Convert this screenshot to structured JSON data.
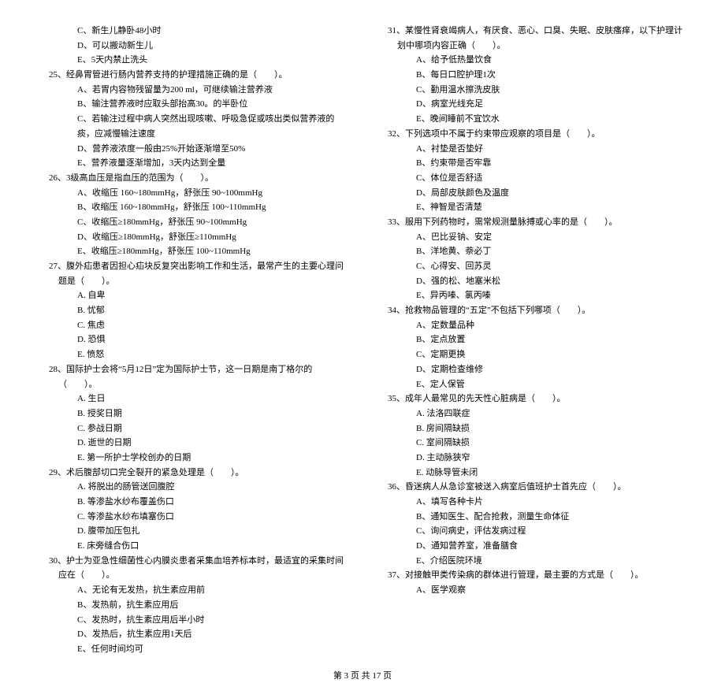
{
  "left": {
    "preC": "C、新生儿静卧48小时",
    "preD": "D、可以搬动新生儿",
    "preE": "E、5天内禁止洗头",
    "q25": "25、经鼻胃管进行肠内营养支持的护理措施正确的是（　　）。",
    "q25A": "A、若胃内容物残留量为200 ml，可继续输注营养液",
    "q25B": "B、输注营养液时应取头部抬高30。的半卧位",
    "q25C": "C、若输注过程中病人突然出现咳嗽、呼吸急促或咳出类似营养液的痰，应减慢输注速度",
    "q25D": "D、营养液浓度一般由25%开始逐渐增至50%",
    "q25E": "E、营养液量逐渐增加，3天内达到全量",
    "q26": "26、3级高血压是指血压的范围为（　　）。",
    "q26A": "A、收缩压 160~180mmHg，舒张压 90~100mmHg",
    "q26B": "B、收缩压 160~180mmHg，舒张压 100~110mmHg",
    "q26C": "C、收缩压≥180mmHg，舒张压 90~100mmHg",
    "q26D": "D、收缩压≥180mmHg，舒张压≥110mmHg",
    "q26E": "E、收缩压≥180mmHg，舒张压 100~110mmHg",
    "q27": "27、腹外疝患者因担心疝块反复突出影响工作和生活，最常产生的主要心理问题是（　　）。",
    "q27A": "A. 自卑",
    "q27B": "B. 忧郁",
    "q27C": "C. 焦虑",
    "q27D": "D. 恐惧",
    "q27E": "E. 愤怒",
    "q28": "28、国际护士会将“5月12日”定为国际护士节，这一日期是南丁格尔的（　　）。",
    "q28A": "A. 生日",
    "q28B": "B. 授奖日期",
    "q28C": "C. 参战日期",
    "q28D": "D. 逝世的日期",
    "q28E": "E. 第一所护士学校创办的日期",
    "q29": "29、术后腹部切口完全裂开的紧急处理是（　　）。",
    "q29A": "A. 将脱出的肠管送回腹腔",
    "q29B": "B. 等渗盐水纱布覆盖伤口",
    "q29C": "C. 等渗盐水纱布填塞伤口",
    "q29D": "D. 腹带加压包扎",
    "q29E": "E. 床旁缝合伤口",
    "q30": "30、护士为亚急性细菌性心内膜炎患者采集血培养标本时，最适宜的采集时间应在（　　）。",
    "q30A": "A、无论有无发热，抗生素应用前",
    "q30B": "B、发热前，抗生素应用后",
    "q30C": "C、发热时，抗生素应用后半小时",
    "q30D": "D、发热后，抗生素应用1天后",
    "q30E": "E、任何时间均可"
  },
  "right": {
    "q31": "31、某慢性肾衰竭病人，有厌食、恶心、口臭、失眠、皮肤瘙痒，以下护理计划中哪项内容正确（　　）。",
    "q31A": "A、给予低热量饮食",
    "q31B": "B、每日口腔护理1次",
    "q31C": "C、勤用温水擦洗皮肤",
    "q31D": "D、病室光线充足",
    "q31E": "E、晚间睡前不宜饮水",
    "q32": "32、下列选项中不属于约束带应观察的项目是（　　）。",
    "q32A": "A、衬垫是否垫好",
    "q32B": "B、约束带是否牢靠",
    "q32C": "C、体位是否舒适",
    "q32D": "D、局部皮肤颜色及温度",
    "q32E": "E、神智是否清楚",
    "q33": "33、服用下列药物时，需常规测量脉搏或心率的是（　　）。",
    "q33A": "A、巴比妥钠、安定",
    "q33B": "B、洋地黄、萘必丁",
    "q33C": "C、心得安、回苏灵",
    "q33D": "D、强的松、地塞米松",
    "q33E": "E、异丙嗪、氯丙嗪",
    "q34": "34、抢救物品管理的“五定”不包括下列哪项（　　）。",
    "q34A": "A、定数量品种",
    "q34B": "B、定点放置",
    "q34C": "C、定期更换",
    "q34D": "D、定期检查维修",
    "q34E": "E、定人保管",
    "q35": "35、成年人最常见的先天性心脏病是（　　）。",
    "q35A": "A. 法洛四联症",
    "q35B": "B. 房间隔缺损",
    "q35C": "C. 室间隔缺损",
    "q35D": "D. 主动脉狭窄",
    "q35E": "E. 动脉导管未闭",
    "q36": "36、昏迷病人从急诊室被送入病室后值班护士首先应（　　）。",
    "q36A": "A、填写各种卡片",
    "q36B": "B、通知医生、配合抢救，测量生命体征",
    "q36C": "C、询问病史，评估发病过程",
    "q36D": "D、通知营养室，准备膳食",
    "q36E": "E、介绍医院环境",
    "q37": "37、对接触甲类传染病的群体进行管理，最主要的方式是（　　）。",
    "q37A": "A、医学观察"
  },
  "footer": "第 3 页 共 17 页"
}
